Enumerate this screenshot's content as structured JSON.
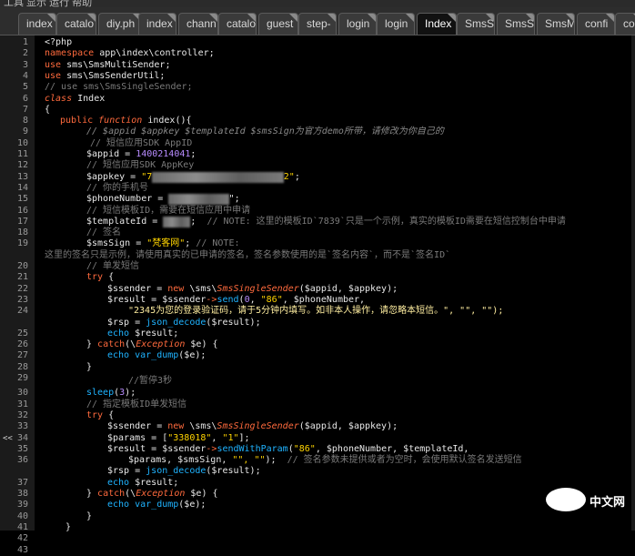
{
  "tabs": [
    {
      "label": "index",
      "active": false
    },
    {
      "label": "catalo",
      "active": false
    },
    {
      "label": "diy.ph",
      "active": false
    },
    {
      "label": "index",
      "active": false
    },
    {
      "label": "chann",
      "active": false
    },
    {
      "label": "catalo",
      "active": false
    },
    {
      "label": "guest",
      "active": false
    },
    {
      "label": "step-",
      "active": false
    },
    {
      "label": "login",
      "active": false
    },
    {
      "label": "login",
      "active": false
    },
    {
      "label": "Index",
      "active": true
    },
    {
      "label": "SmsSi",
      "active": false
    },
    {
      "label": "SmsS",
      "active": false
    },
    {
      "label": "SmsM",
      "active": false
    },
    {
      "label": "confi",
      "active": false
    },
    {
      "label": "conf",
      "active": false
    }
  ],
  "gutter": {
    "line_numbers": [
      "1",
      "2",
      "3",
      "4",
      "5",
      "6",
      "7",
      "8",
      "9",
      "10",
      "11",
      "12",
      "13",
      "14",
      "15",
      "16",
      "17",
      "18",
      "19",
      "",
      "20",
      "21",
      "22",
      "23",
      "24",
      "",
      "25",
      "26",
      "27",
      "28",
      "29",
      "30",
      "31",
      "32",
      "33",
      "34",
      "35",
      "36",
      "",
      "37",
      "38",
      "39",
      "40",
      "41",
      "42",
      "43"
    ],
    "breakpoint_marker": "<<"
  },
  "code": {
    "l1": "<?php",
    "l2_kw": "namespace",
    "l2_rest": " app\\index\\controller;",
    "l3_kw": "use",
    "l3_rest": " sms\\SmsMultiSender;",
    "l4_kw": "use",
    "l4_rest": " sms\\SmsSenderUtil;",
    "l5": "// use sms\\SmsSingleSender;",
    "l6_kw": "class",
    "l6_rest": " Index",
    "l7": "{",
    "l8_kw1": "public",
    "l8_kw2": "function",
    "l8_rest": " index(){",
    "l9": "// $appid $appkey $templateId $smsSign为官方demo所带，请修改为你自己的",
    "l10": "// 短信应用SDK AppID",
    "l11_var": "$appid",
    "l11_eq": " = ",
    "l11_num": "1400214041",
    "l11_end": ";",
    "l12": "// 短信应用SDK AppKey",
    "l13_var": "$appkey",
    "l13_eq": " = ",
    "l13_s1": "\"7",
    "l13_s2": "2\"",
    "l13_end": ";",
    "l14": "// 你的手机号",
    "l15_var": "$phoneNumber",
    "l15_eq": " = ",
    "l15_end": "\";",
    "l16": "// 短信模板ID，需要在短信应用中申请",
    "l17_var": "$templateId",
    "l17_eq": " = ",
    "l17_semi": ";",
    "l17_cmt": "  // NOTE: 这里的模板ID`7839`只是一个示例，真实的模板ID需要在短信控制台中申请",
    "l18": "// 签名",
    "l19_var": "$smsSign",
    "l19_eq": " = ",
    "l19_str": "\"梵客网\"",
    "l19_semi": ";",
    "l19_cmt": " // NOTE:",
    "l19_cont": "这里的签名只是示例，请使用真实的已申请的签名，签名参数使用的是`签名内容`，而不是`签名ID`",
    "l20": "// 单发短信",
    "l21_kw": "try",
    "l21_rest": " {",
    "l22_var": "$ssender",
    "l22_eq": " = ",
    "l22_new": "new",
    "l22_ns": " \\sms\\",
    "l22_cls": "SmsSingleSender",
    "l22_args": "($appid, $appkey);",
    "l23_var": "$result",
    "l23_eq": " = ",
    "l23_var2": "$ssender",
    "l23_arrow": "->",
    "l23_fn": "send",
    "l23_open": "(",
    "l23_zero": "0",
    "l23_c1": ", ",
    "l23_86": "\"86\"",
    "l23_rest": ", $phoneNumber,",
    "l23_cont": "\"2345为您的登录验证码，请于5分钟内填写。如非本人操作，请忽略本短信。\", \"\", \"\");",
    "l24_var": "$rsp",
    "l24_eq": " = ",
    "l24_fn": "json_decode",
    "l24_rest": "($result);",
    "l25_kw": "echo",
    "l25_rest": " $result;",
    "l26_a": "} ",
    "l26_kw": "catch",
    "l26_b": "(\\",
    "l26_cls": "Exception",
    "l26_c": " $e) {",
    "l27_kw": "echo",
    "l27_fn": " var_dump",
    "l27_rest": "($e);",
    "l28": "}",
    "l30": "//暂停3秒",
    "l31_fn": "sleep",
    "l31_open": "(",
    "l31_num": "3",
    "l31_end": ");",
    "l32": "// 指定模板ID单发短信",
    "l33_kw": "try",
    "l33_rest": " {",
    "l34_var": "$ssender",
    "l34_eq": " = ",
    "l34_new": "new",
    "l34_ns": " \\sms\\",
    "l34_cls": "SmsSingleSender",
    "l34_args": "($appid, $appkey);",
    "l35_var": "$params",
    "l35_eq": " = [",
    "l35_s1": "\"338018\"",
    "l35_c": ", ",
    "l35_s2": "\"1\"",
    "l35_end": "];",
    "l36_var": "$result",
    "l36_eq": " = ",
    "l36_var2": "$ssender",
    "l36_arrow": "->",
    "l36_fn": "sendWithParam",
    "l36_open": "(",
    "l36_86": "\"86\"",
    "l36_rest": ", $phoneNumber, $templateId,",
    "l36_cont_a": "$params, $smsSign, ",
    "l36_cont_s": "\"\", \"\"",
    "l36_cont_b": ");",
    "l36_cmt": "  // 签名参数未提供或者为空时，会使用默认签名发送短信",
    "l37_var": "$rsp",
    "l37_eq": " = ",
    "l37_fn": "json_decode",
    "l37_rest": "($result);",
    "l38_kw": "echo",
    "l38_rest": " $result;",
    "l39_a": "} ",
    "l39_kw": "catch",
    "l39_b": "(\\",
    "l39_cls": "Exception",
    "l39_c": " $e) {",
    "l40_kw": "echo",
    "l40_fn": " var_dump",
    "l40_rest": "($e);",
    "l41": "}",
    "l42": "}"
  },
  "watermark": {
    "text": "中文网"
  },
  "colors": {
    "keyword": "#ff6a3d",
    "string": "#ffd400",
    "number": "#b88cff",
    "function": "#1fb3ff",
    "comment": "#7a7a7a",
    "background": "#000000"
  }
}
